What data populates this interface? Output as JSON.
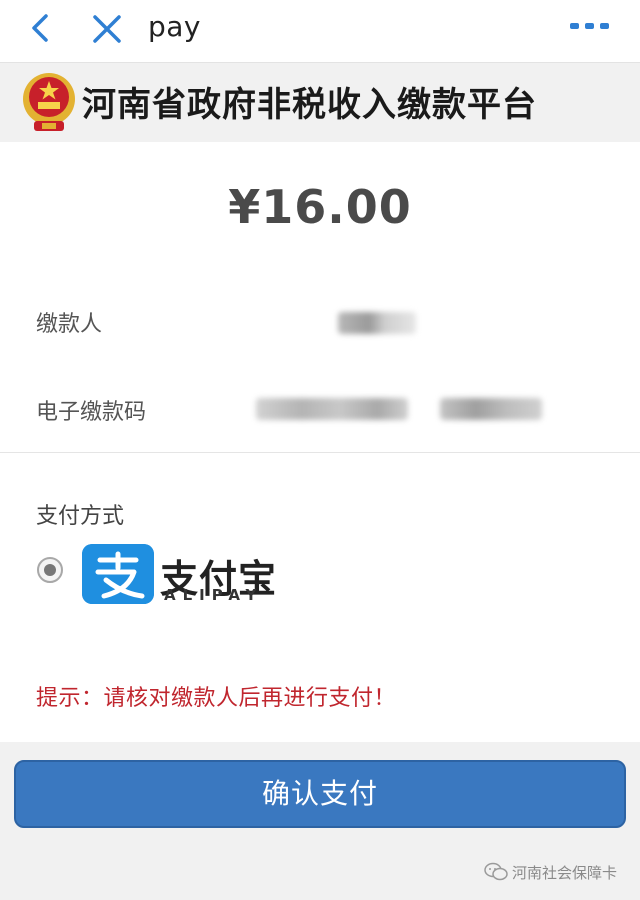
{
  "nav": {
    "title": "pay",
    "back_icon": "back-chevron-icon",
    "close_icon": "close-icon",
    "more_icon": "more-icon",
    "accent_color": "#2f7fd3"
  },
  "header": {
    "title": "河南省政府非税收入缴款平台",
    "emblem_icon": "national-emblem-icon"
  },
  "payment": {
    "amount": "¥16.00",
    "payer_label": "缴款人",
    "code_label": "电子缴款码",
    "method_label": "支付方式",
    "methods": [
      {
        "name_cn": "支付宝",
        "name_en": "ALIPAY",
        "selected": true,
        "brand_color": "#1f8fe0"
      }
    ],
    "hint": "提示：请核对缴款人后再进行支付！",
    "hint_color": "#c0262e",
    "confirm_label": "确认支付",
    "confirm_color": "#3a78c0"
  },
  "watermark": {
    "text": "河南社会保障卡",
    "icon": "wechat-icon"
  }
}
